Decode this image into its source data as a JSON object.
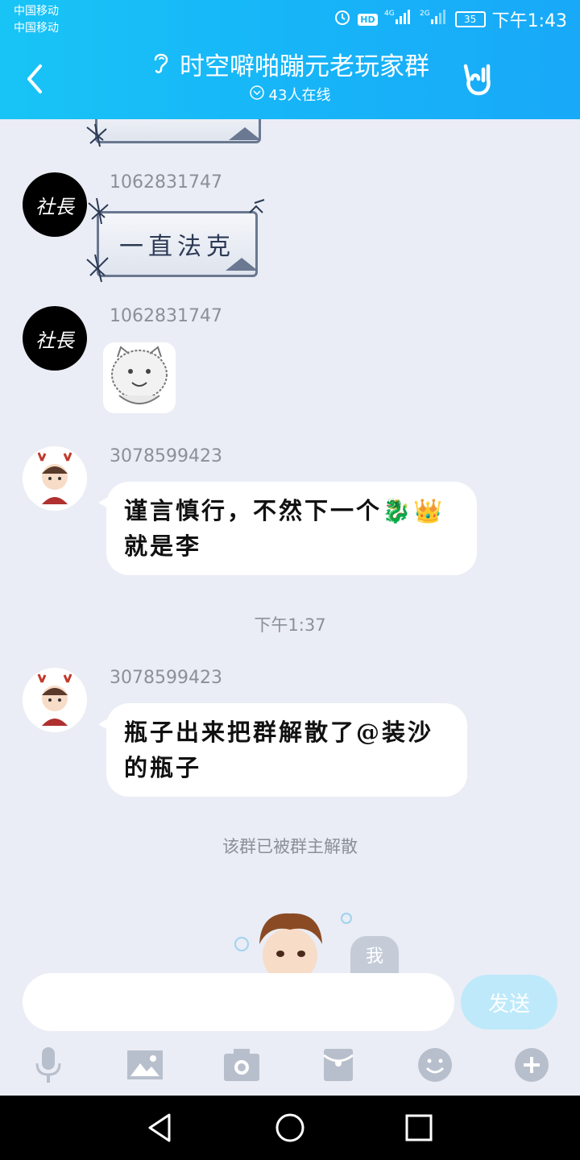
{
  "status_bar": {
    "carrier_1": "中国移动",
    "carrier_2": "中国移动",
    "hd_label": "HD",
    "net_1": "4G",
    "net_2": "2G",
    "battery": "35",
    "time": "下午1:43"
  },
  "header": {
    "title": "时空噼啪蹦元老玩家群",
    "online": "43人在线",
    "icons": [
      "back-arrow-icon",
      "ear-icon",
      "rock-hand-icon",
      "chevron-circle-icon"
    ]
  },
  "messages": [
    {
      "sender": "1062831747",
      "avatar_text": "社長",
      "type": "sticker",
      "text": "一直法克"
    },
    {
      "sender": "1062831747",
      "avatar_text": "社長",
      "type": "sticker-image"
    },
    {
      "sender": "3078599423",
      "type": "text",
      "text": "谨言慎行，不然下一个🐉👑就是李"
    },
    {
      "sender": "3078599423",
      "type": "text",
      "text": "瓶子出来把群解散了@装沙的瓶子"
    }
  ],
  "time_separator": "下午1:37",
  "system_notice": "该群已被群主解散",
  "self_label": "我",
  "input": {
    "placeholder": "",
    "send_label": "发送"
  },
  "toolbar_icons": [
    "microphone-icon",
    "image-icon",
    "camera-icon",
    "red-packet-icon",
    "emoji-icon",
    "plus-icon"
  ],
  "colors": {
    "header_blue": "#18b5f8",
    "chat_bg": "#eaedf5",
    "send_disabled": "#bde9fb"
  }
}
